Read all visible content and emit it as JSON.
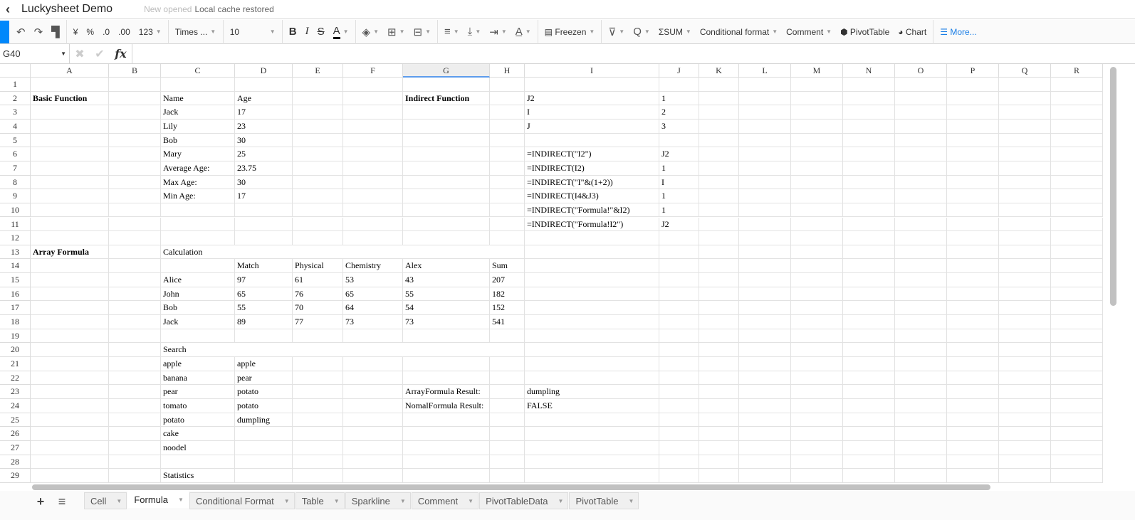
{
  "app": {
    "title": "Luckysheet Demo",
    "status_muted": "New opened",
    "status": "Local cache restored"
  },
  "toolbar": {
    "currency": "¥",
    "percent": "%",
    "dec_decrease": ".0",
    "dec_increase": ".00",
    "number_format": "123",
    "font": "Times ...",
    "font_size": "10",
    "bold": "B",
    "italic": "I",
    "strike": "S",
    "text_color": "A",
    "freeze": "Freezen",
    "sum": "SUM",
    "conditional_format": "Conditional format",
    "comment": "Comment",
    "pivot": "PivotTable",
    "chart": "Chart",
    "more": "More...",
    "accent_color": "#0188fb"
  },
  "formula_bar": {
    "cell_ref": "G40",
    "value": "",
    "fx": "fx"
  },
  "sheet": {
    "columns": [
      "A",
      "B",
      "C",
      "D",
      "E",
      "F",
      "G",
      "H",
      "I",
      "J",
      "K",
      "L",
      "M",
      "N",
      "O",
      "P",
      "Q",
      "R"
    ],
    "selected_column": "G",
    "rows": 29,
    "bold_cells": [
      "A2",
      "G2",
      "A13"
    ],
    "merges": [
      "C13:H13",
      "C20:H20"
    ],
    "cells": {
      "A2": "Basic Function",
      "C2": "Name",
      "D2": "Age",
      "G2": "Indirect Function",
      "I2": "J2",
      "J2": "1",
      "C3": "Jack",
      "D3": "17",
      "I3": "I",
      "J3": "2",
      "C4": "Lily",
      "D4": "23",
      "I4": "J",
      "J4": "3",
      "C5": "Bob",
      "D5": "30",
      "C6": "Mary",
      "D6": "25",
      "I6": "=INDIRECT(\"I2\")",
      "J6": "J2",
      "C7": "Average Age:",
      "D7": "23.75",
      "I7": "=INDIRECT(I2)",
      "J7": "1",
      "C8": "Max Age:",
      "D8": "30",
      "I8": "=INDIRECT(\"I\"&(1+2))",
      "J8": "I",
      "C9": "Min Age:",
      "D9": "17",
      "I9": "=INDIRECT(I4&J3)",
      "J9": "1",
      "I10": "=INDIRECT(\"Formula!\"&I2)",
      "J10": "1",
      "I11": "=INDIRECT(\"Formula!I2\")",
      "J11": "J2",
      "A13": "Array Formula",
      "C13": "Calculation",
      "D14": "Match",
      "E14": "Physical",
      "F14": "Chemistry",
      "G14": "Alex",
      "H14": "Sum",
      "C15": "Alice",
      "D15": "97",
      "E15": "61",
      "F15": "53",
      "G15": "43",
      "H15": "207",
      "C16": "John",
      "D16": "65",
      "E16": "76",
      "F16": "65",
      "G16": "55",
      "H16": "182",
      "C17": "Bob",
      "D17": "55",
      "E17": "70",
      "F17": "64",
      "G17": "54",
      "H17": "152",
      "C18": "Jack",
      "D18": "89",
      "E18": "77",
      "F18": "73",
      "G18": "73",
      "H18": "541",
      "C20": "Search",
      "C21": "apple",
      "D21": "apple",
      "C22": "banana",
      "D22": "pear",
      "C23": "pear",
      "D23": "potato",
      "G23": "ArrayFormula Result:",
      "I23": "dumpling",
      "C24": "tomato",
      "D24": "potato",
      "G24": "NomalFormula Result:",
      "I24": "FALSE",
      "C25": "potato",
      "D25": "dumpling",
      "C26": "cake",
      "C27": "noodel",
      "C29": "Statistics"
    }
  },
  "sheet_tabs": [
    {
      "label": "Cell"
    },
    {
      "label": "Formula",
      "active": true
    },
    {
      "label": "Conditional Format"
    },
    {
      "label": "Table"
    },
    {
      "label": "Sparkline"
    },
    {
      "label": "Comment"
    },
    {
      "label": "PivotTableData"
    },
    {
      "label": "PivotTable"
    }
  ]
}
